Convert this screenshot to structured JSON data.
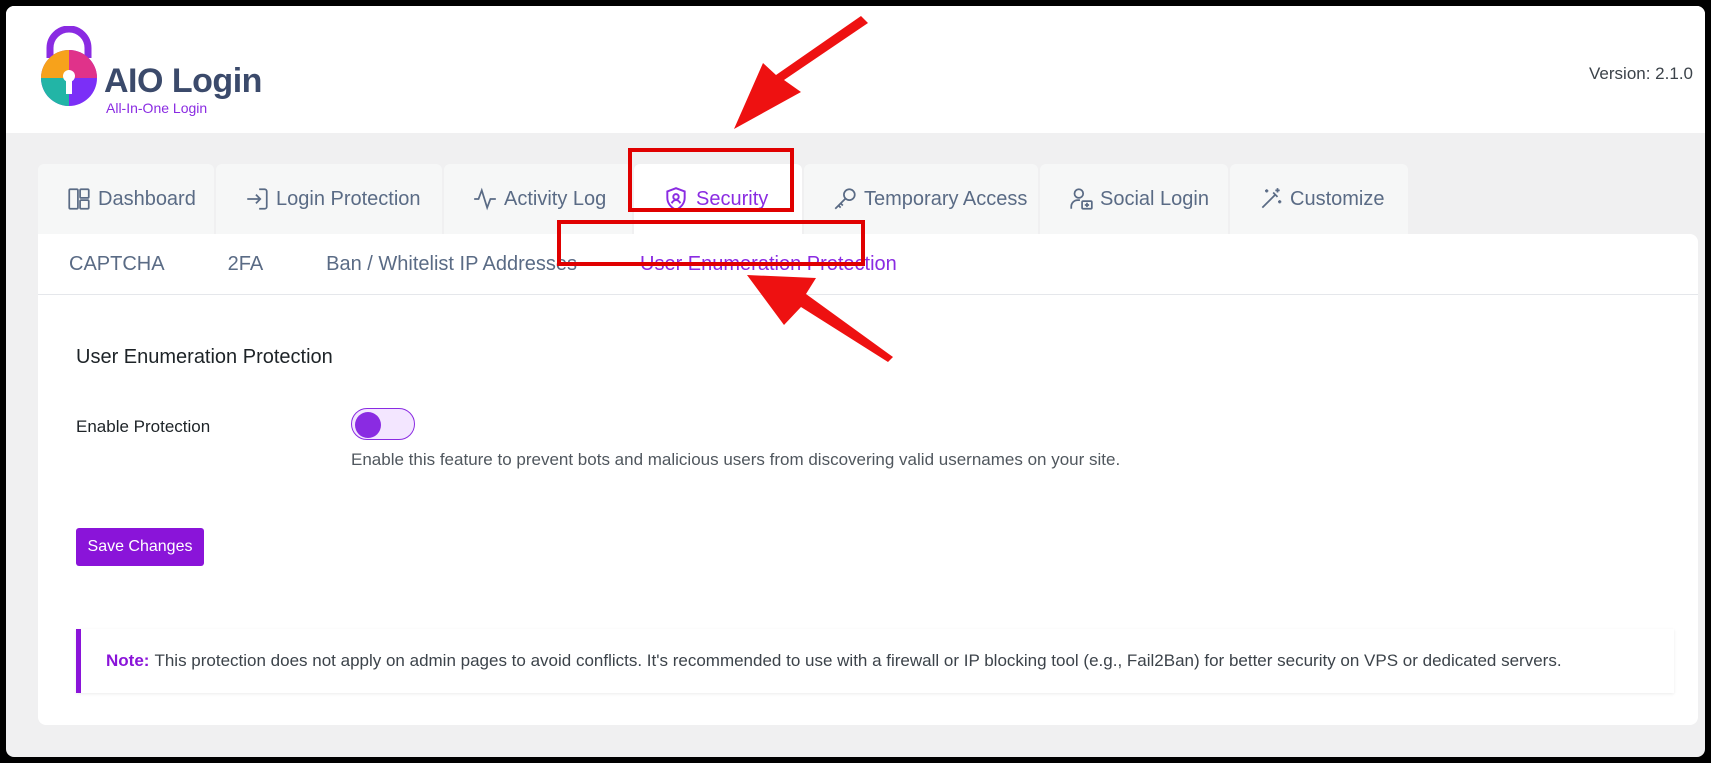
{
  "app": {
    "logo_title": "AIO Login",
    "logo_subtitle": "All-In-One Login",
    "version": "Version: 2.1.0"
  },
  "tabs": [
    {
      "label": "Dashboard",
      "icon": "dashboard-icon"
    },
    {
      "label": "Login Protection",
      "icon": "login-icon"
    },
    {
      "label": "Activity Log",
      "icon": "activity-icon"
    },
    {
      "label": "Security",
      "icon": "shield-icon",
      "active": true
    },
    {
      "label": "Temporary Access",
      "icon": "key-icon"
    },
    {
      "label": "Social Login",
      "icon": "user-plus-icon"
    },
    {
      "label": "Customize",
      "icon": "magic-wand-icon"
    }
  ],
  "subtabs": [
    {
      "label": "CAPTCHA"
    },
    {
      "label": "2FA"
    },
    {
      "label": "Ban / Whitelist IP Addresses"
    },
    {
      "label": "User Enumeration Protection",
      "active": true
    }
  ],
  "section": {
    "title": "User Enumeration Protection",
    "field_label": "Enable Protection",
    "toggle_enabled": false,
    "description": "Enable this feature to prevent bots and malicious users from discovering valid usernames on your site.",
    "save_label": "Save Changes"
  },
  "note": {
    "label": "Note:",
    "text": "This protection does not apply on admin pages to avoid conflicts. It's recommended to use with a firewall or IP blocking tool (e.g., Fail2Ban) for better security on VPS or dedicated servers."
  },
  "colors": {
    "accent": "#8a2be2",
    "annotation": "#e00000",
    "text_muted": "#5a6b85"
  }
}
